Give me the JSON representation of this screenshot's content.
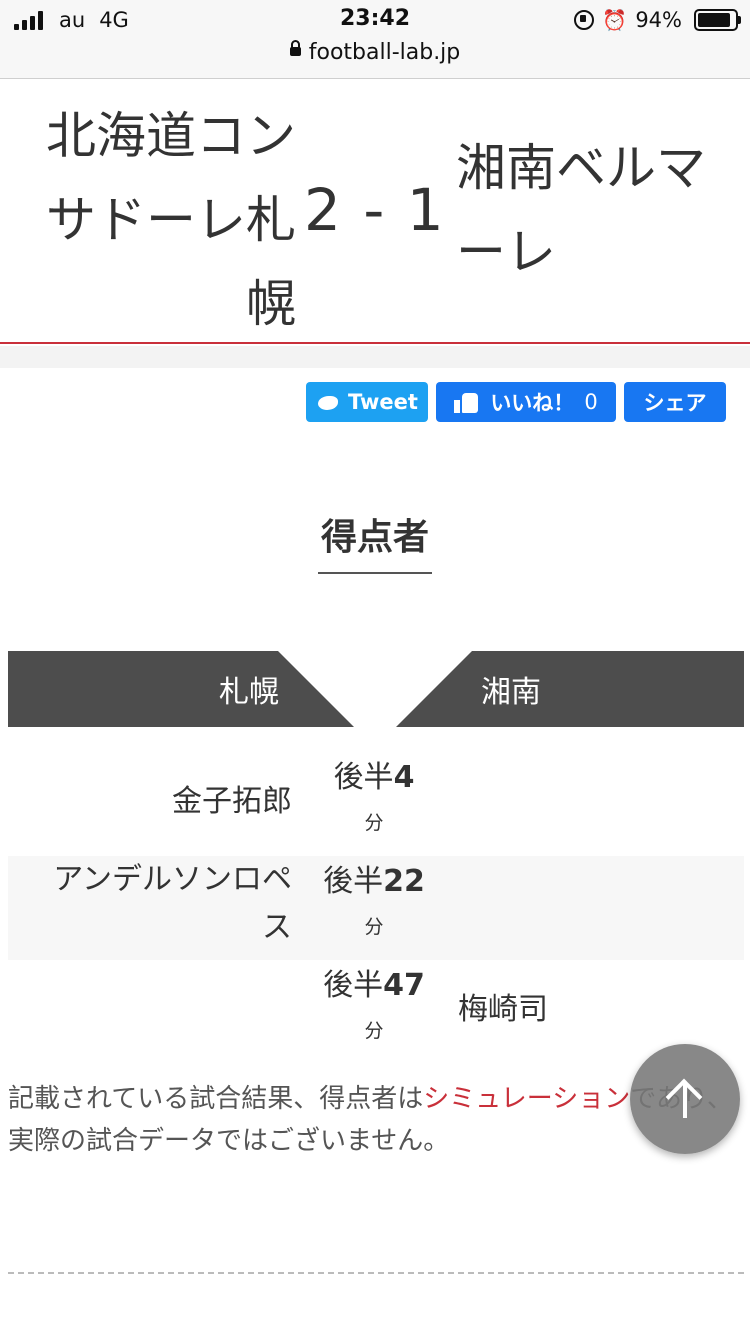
{
  "status_bar": {
    "carrier": "au",
    "network": "4G",
    "time": "23:42",
    "battery": "94%",
    "battery_level": 0.94,
    "url": "football-lab.jp"
  },
  "match": {
    "home_team": "北海道コンサドーレ札幌",
    "score": "2 - 1",
    "away_team": "湘南ベルマーレ"
  },
  "share": {
    "tweet": "Tweet",
    "like": "いいね！",
    "like_count": "0",
    "share": "シェア"
  },
  "scorers": {
    "title": "得点者",
    "home_short": "札幌",
    "away_short": "湘南",
    "goals": [
      {
        "home": "金子拓郎",
        "period": "後半",
        "minute": "4",
        "unit": "分",
        "away": ""
      },
      {
        "home": "アンデルソンロペス",
        "period": "後半",
        "minute": "22",
        "unit": "分",
        "away": ""
      },
      {
        "home": "",
        "period": "後半",
        "minute": "47",
        "unit": "分",
        "away": "梅崎司"
      }
    ]
  },
  "note": {
    "before": "記載されている試合結果、得点者は",
    "link": "シミュレーション",
    "after": "であり、実際の試合データではございません。"
  },
  "colors": {
    "accent_red": "#c9303a",
    "twitter_blue": "#1da1f2",
    "facebook_blue": "#1877f2",
    "banner_gray": "#4d4d4d"
  }
}
